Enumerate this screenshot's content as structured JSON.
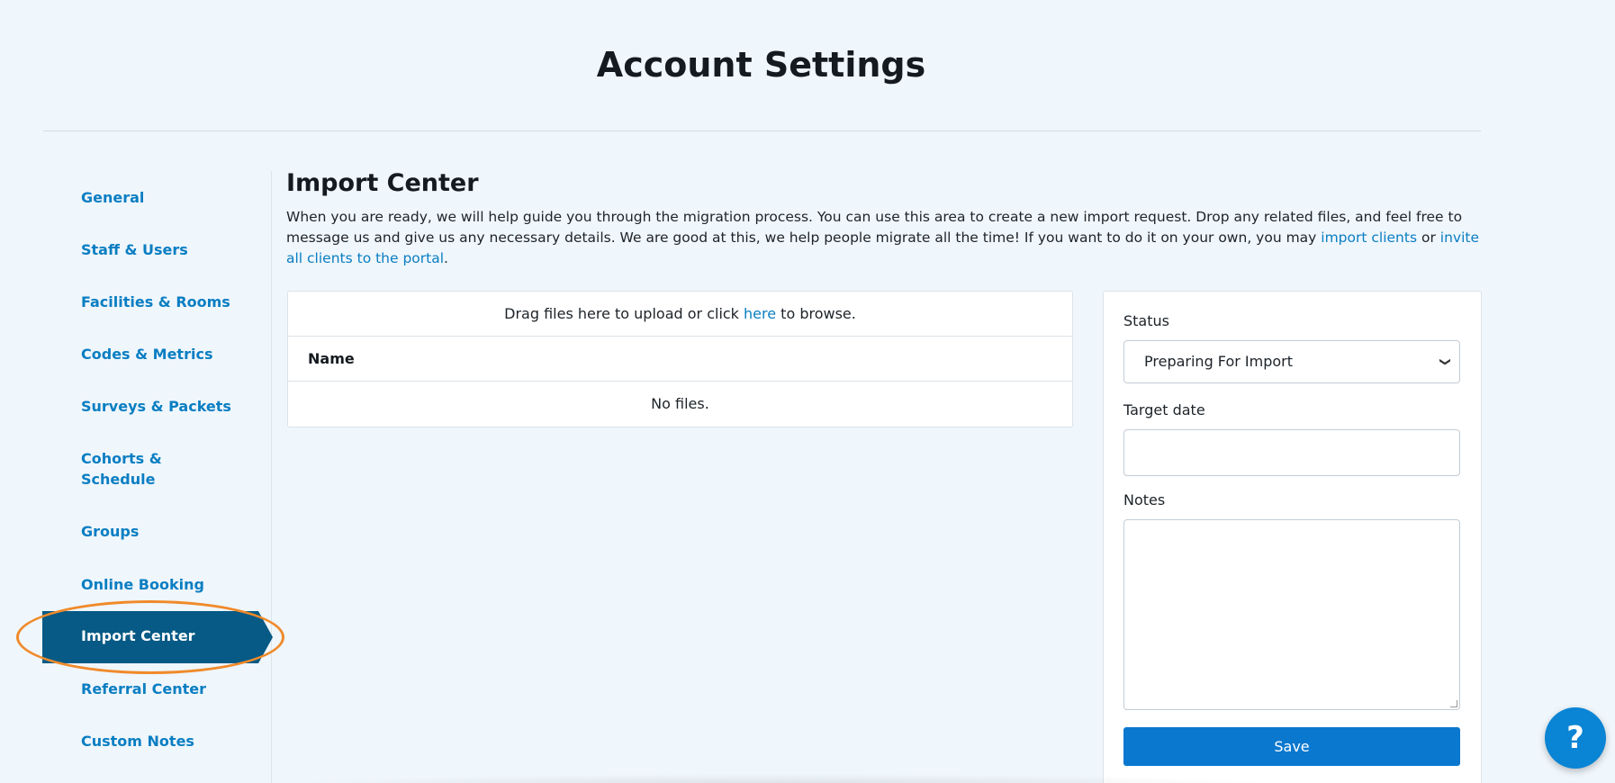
{
  "header": {
    "title": "Account Settings"
  },
  "sidebar": {
    "items": [
      {
        "label": "General"
      },
      {
        "label": "Staff & Users"
      },
      {
        "label": "Facilities & Rooms"
      },
      {
        "label": "Codes & Metrics"
      },
      {
        "label": "Surveys & Packets"
      },
      {
        "label": "Cohorts & Schedule"
      },
      {
        "label": "Groups"
      },
      {
        "label": "Online Booking"
      },
      {
        "label": "Import Center"
      },
      {
        "label": "Referral Center"
      },
      {
        "label": "Custom Notes"
      }
    ],
    "active_label": "Import Center"
  },
  "main": {
    "title": "Import Center",
    "intro_text": "When you are ready, we will help guide you through the migration process. You can use this area to create a new import request. Drop any related files, and feel free to message us and give us any necessary details. We are good at this, we help people migrate all the time! If you want to do it on your own, you may ",
    "intro_link_import": "import clients",
    "intro_or": " or ",
    "intro_link_invite": "invite all clients to the portal",
    "intro_end": ".",
    "files": {
      "drop_prefix": "Drag files here to upload or click ",
      "drop_link": "here",
      "drop_suffix": " to browse.",
      "column_name": "Name",
      "empty_text": "No files."
    },
    "form": {
      "status_label": "Status",
      "status_value": "Preparing For Import",
      "target_date_label": "Target date",
      "target_date_value": "",
      "notes_label": "Notes",
      "notes_value": "",
      "save_label": "Save"
    }
  },
  "help_button": {
    "label": "?"
  },
  "colors": {
    "accent": "#0a7ec2",
    "active_nav": "#065a85",
    "highlight": "#f08a2a",
    "save_button": "#0a78cf"
  }
}
